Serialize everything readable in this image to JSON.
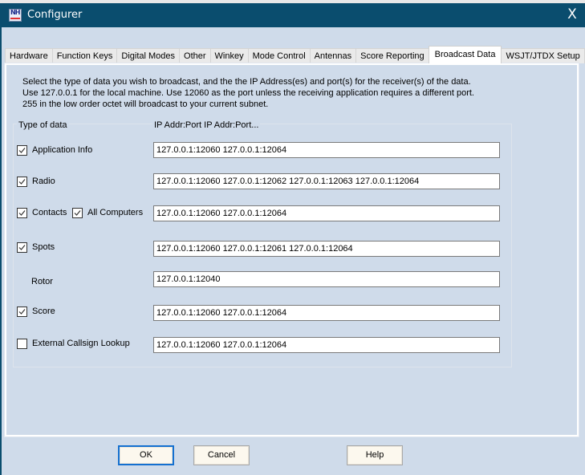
{
  "window": {
    "title": "Configurer",
    "close_glyph": "X",
    "icon": "app-logo-icon"
  },
  "tabs": [
    {
      "label": "Hardware",
      "active": false
    },
    {
      "label": "Function Keys",
      "active": false
    },
    {
      "label": "Digital Modes",
      "active": false
    },
    {
      "label": "Other",
      "active": false
    },
    {
      "label": "Winkey",
      "active": false
    },
    {
      "label": "Mode Control",
      "active": false
    },
    {
      "label": "Antennas",
      "active": false
    },
    {
      "label": "Score Reporting",
      "active": false
    },
    {
      "label": "Broadcast Data",
      "active": true
    },
    {
      "label": "WSJT/JTDX Setup",
      "active": false
    }
  ],
  "intro": {
    "line1": "Select the type of data you wish to broadcast, and the the IP Address(es) and port(s) for the receiver(s) of the data.",
    "line2": "Use 127.0.0.1 for the local machine.  Use 12060 as the port unless the receiving application requires a different port.",
    "line3": "255 in the low order octet will broadcast to your current subnet."
  },
  "group": {
    "type_label": "Type of data",
    "addr_label": "IP Addr:Port IP Addr:Port..."
  },
  "rows": {
    "app_info": {
      "label": "Application Info",
      "checked": true,
      "value": "127.0.0.1:12060 127.0.0.1:12064"
    },
    "radio": {
      "label": "Radio",
      "checked": true,
      "value": "127.0.0.1:12060 127.0.0.1:12062 127.0.0.1:12063 127.0.0.1:12064"
    },
    "contacts": {
      "label": "Contacts",
      "checked": true,
      "value": "127.0.0.1:12060 127.0.0.1:12064"
    },
    "all_computers": {
      "label": "All Computers",
      "checked": true
    },
    "spots": {
      "label": "Spots",
      "checked": true,
      "value": "127.0.0.1:12060 127.0.0.1:12061 127.0.0.1:12064"
    },
    "rotor": {
      "label": "Rotor",
      "value": "127.0.0.1:12040"
    },
    "score": {
      "label": "Score",
      "checked": true,
      "value": "127.0.0.1:12060 127.0.0.1:12064"
    },
    "callsign_lookup": {
      "label": "External Callsign Lookup",
      "checked": false,
      "value": "127.0.0.1:12060 127.0.0.1:12064"
    }
  },
  "buttons": {
    "ok": "OK",
    "cancel": "Cancel",
    "help": "Help"
  },
  "colors": {
    "titlebar": "#0a4d6e",
    "background": "#cfdbea",
    "default_button_border": "#1470d0"
  }
}
